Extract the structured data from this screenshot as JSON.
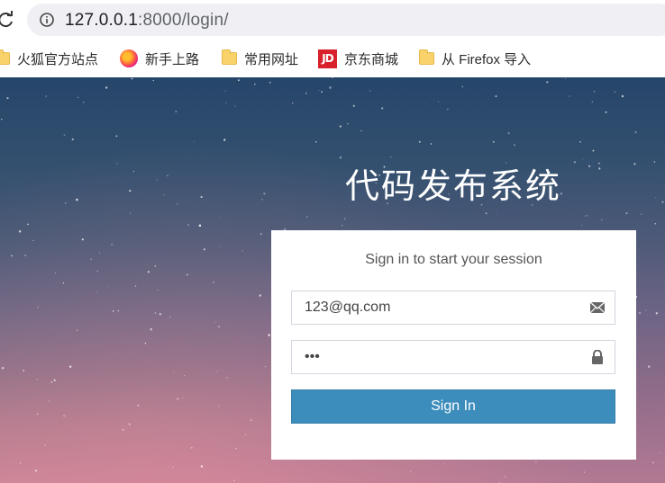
{
  "browser": {
    "url_host": "127.0.0.1",
    "url_rest": ":8000/login/",
    "bookmarks": [
      {
        "label": "火狐官方站点",
        "icon": "folder-icon"
      },
      {
        "label": "新手上路",
        "icon": "firefox-icon"
      },
      {
        "label": "常用网址",
        "icon": "folder-icon"
      },
      {
        "label": "京东商城",
        "icon": "jd-icon"
      },
      {
        "label": "从 Firefox 导入",
        "icon": "folder-icon"
      }
    ],
    "jd_icon_text": "JD"
  },
  "page": {
    "title": "代码发布系统",
    "login": {
      "message": "Sign in to start your session",
      "email_value": "123@qq.com",
      "password_value": "•••",
      "submit_label": "Sign In"
    }
  },
  "colors": {
    "button": "#3c8dbc",
    "url_field": "#f0f0f4"
  }
}
